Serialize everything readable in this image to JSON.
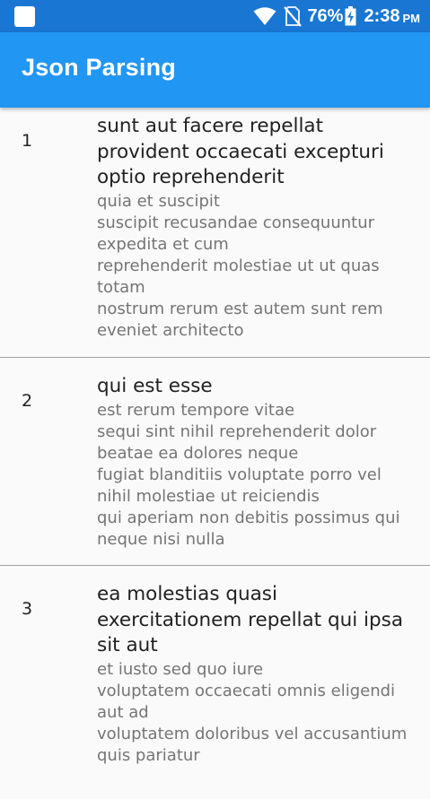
{
  "status_bar": {
    "battery_percent": "76%",
    "time": "2:38",
    "ampm": "PM",
    "icons": [
      "notification-icon",
      "wifi-icon",
      "no-sim-icon",
      "battery-charging-icon"
    ]
  },
  "app_bar": {
    "title": "Json Parsing",
    "color": "#2196f3"
  },
  "posts": [
    {
      "id": "1",
      "title": "sunt aut facere repellat provident occaecati excepturi optio reprehenderit",
      "body": "quia et suscipit\nsuscipit recusandae consequuntur expedita et cum\nreprehenderit molestiae ut ut quas totam\nnostrum rerum est autem sunt rem eveniet architecto"
    },
    {
      "id": "2",
      "title": "qui est esse",
      "body": "est rerum tempore vitae\nsequi sint nihil reprehenderit dolor beatae ea dolores neque\nfugiat blanditiis voluptate porro vel nihil molestiae ut reiciendis\nqui aperiam non debitis possimus qui neque nisi nulla"
    },
    {
      "id": "3",
      "title": "ea molestias quasi exercitationem repellat qui ipsa sit aut",
      "body": "et iusto sed quo iure\nvoluptatem occaecati omnis eligendi aut ad\nvoluptatem doloribus vel accusantium quis pariatur"
    }
  ]
}
